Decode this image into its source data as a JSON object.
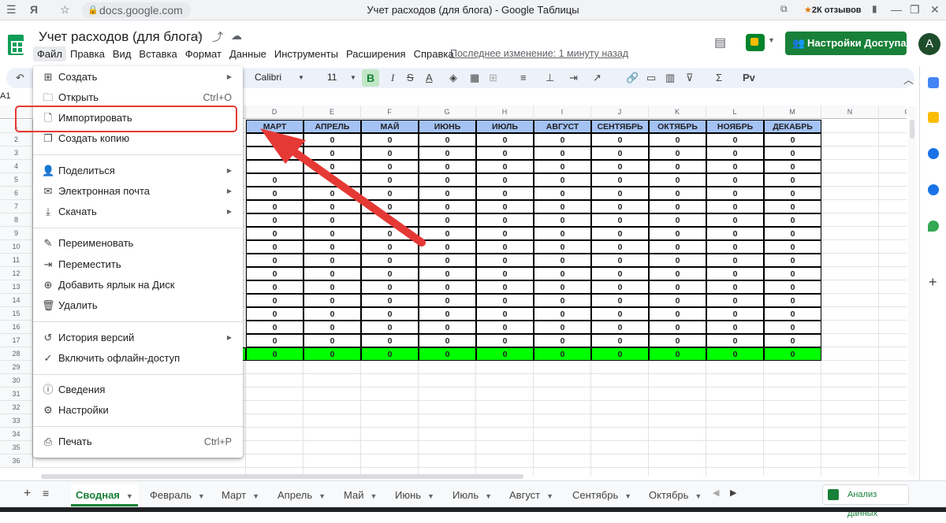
{
  "browser": {
    "url": "docs.google.com",
    "window_title": "Учет расходов (для блога) - Google Таблицы",
    "reviews_star": "★",
    "reviews": "2К отзывов"
  },
  "doc": {
    "title": "Учет расходов (для блога)",
    "last_edit": "Последнее изменение: 1 минуту назад",
    "share_label": "Настройки Доступа",
    "avatar_letter": "A"
  },
  "menubar": [
    "Файл",
    "Правка",
    "Вид",
    "Вставка",
    "Формат",
    "Данные",
    "Инструменты",
    "Расширения",
    "Справка"
  ],
  "toolbar": {
    "font": "Calibri",
    "font_size": "11",
    "name_box": "A1"
  },
  "file_menu": {
    "create": "Создать",
    "open": "Открыть",
    "open_shortcut": "Ctrl+O",
    "import": "Импортировать",
    "make_copy": "Создать копию",
    "share": "Поделиться",
    "email": "Электронная почта",
    "download": "Скачать",
    "rename": "Переименовать",
    "move": "Переместить",
    "add_shortcut": "Добавить ярлык на Диск",
    "delete": "Удалить",
    "version_history": "История версий",
    "offline": "Включить офлайн-доступ",
    "details": "Сведения",
    "settings": "Настройки",
    "print": "Печать",
    "print_shortcut": "Ctrl+P"
  },
  "columns": [
    "D",
    "E",
    "F",
    "G",
    "H",
    "I",
    "J",
    "K",
    "L",
    "M",
    "N",
    "O"
  ],
  "row_numbers": [
    "1",
    "2",
    "3",
    "4",
    "5",
    "6",
    "7",
    "8",
    "9",
    "10",
    "11",
    "12",
    "13",
    "14",
    "15",
    "16",
    "17",
    "28",
    "29",
    "30",
    "31",
    "32",
    "33",
    "34",
    "35",
    "36"
  ],
  "months": [
    "МАРТ",
    "АПРЕЛЬ",
    "МАЙ",
    "ИЮНЬ",
    "ИЮЛЬ",
    "АВГУСТ",
    "СЕНТЯБРЬ",
    "ОКТЯБРЬ",
    "НОЯБРЬ",
    "ДЕКАБРЬ"
  ],
  "zero": "0",
  "sheets": [
    "Сводная",
    "Февраль",
    "Март",
    "Апрель",
    "Май",
    "Июнь",
    "Июль",
    "Август",
    "Сентябрь",
    "Октябрь"
  ],
  "explore_label": "Анализ данных",
  "accent": "#188038",
  "highlight_color": "#e53935"
}
